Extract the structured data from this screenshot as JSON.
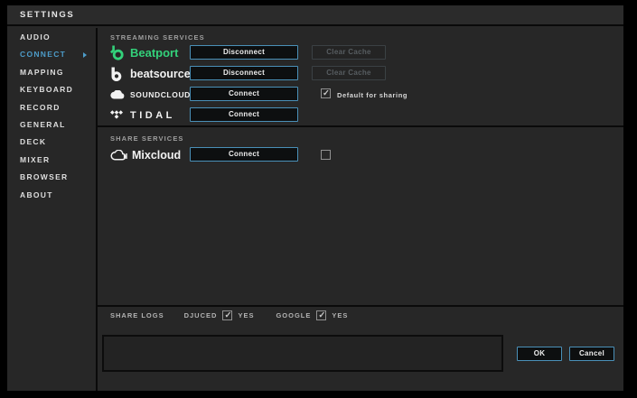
{
  "window": {
    "title": "SETTINGS"
  },
  "sidebar": {
    "items": [
      {
        "label": "AUDIO",
        "active": false
      },
      {
        "label": "CONNECT",
        "active": true
      },
      {
        "label": "MAPPING",
        "active": false
      },
      {
        "label": "KEYBOARD",
        "active": false
      },
      {
        "label": "RECORD",
        "active": false
      },
      {
        "label": "GENERAL",
        "active": false
      },
      {
        "label": "DECK",
        "active": false
      },
      {
        "label": "MIXER",
        "active": false
      },
      {
        "label": "BROWSER",
        "active": false
      },
      {
        "label": "ABOUT",
        "active": false
      }
    ]
  },
  "streaming": {
    "header": "STREAMING SERVICES",
    "rows": [
      {
        "service": "Beatport",
        "action": "Disconnect",
        "secondary": "Clear Cache",
        "secondary_disabled": true
      },
      {
        "service": "beatsource",
        "action": "Disconnect",
        "secondary": "Clear Cache",
        "secondary_disabled": true
      },
      {
        "service": "SOUNDCLOUD",
        "action": "Connect",
        "checkbox_label": "Default for sharing",
        "checked": true
      },
      {
        "service": "TIDAL",
        "action": "Connect"
      }
    ]
  },
  "share_services": {
    "header": "SHARE SERVICES",
    "rows": [
      {
        "service": "Mixcloud",
        "action": "Connect",
        "checked": false
      }
    ]
  },
  "share_logs": {
    "label": "SHARE LOGS",
    "entries": [
      {
        "name": "DJUCED",
        "checked": true,
        "value": "YES"
      },
      {
        "name": "GOOGLE",
        "checked": true,
        "value": "YES"
      }
    ]
  },
  "footer": {
    "ok": "OK",
    "cancel": "Cancel"
  },
  "icons": {
    "check_mark": "✓"
  },
  "colors": {
    "accent_blue": "#4a90b8",
    "sidebar_active": "#4d9cc9",
    "beatport_green": "#33d17a",
    "panel_bg": "#272727",
    "outer_border": "#000000"
  }
}
